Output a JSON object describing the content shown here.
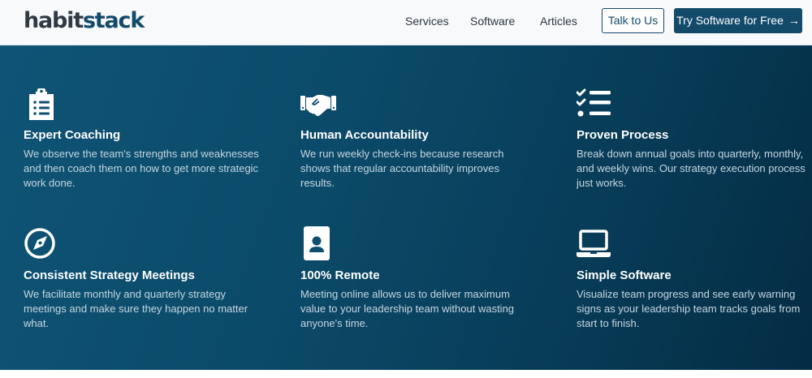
{
  "header": {
    "logo_part1": "habit",
    "logo_part2": "stack",
    "nav": [
      {
        "label": "Services"
      },
      {
        "label": "Software"
      },
      {
        "label": "Articles"
      }
    ],
    "talk_button": "Talk to Us",
    "try_button": "Try Software for Free",
    "try_button_arrow": "→"
  },
  "features": [
    {
      "icon": "clipboard-list-icon",
      "title": "Expert Coaching",
      "description": "We observe the team's strengths and weaknesses and then coach them on how to get more strategic work done."
    },
    {
      "icon": "handshake-icon",
      "title": "Human Accountability",
      "description": "We run weekly check-ins because research shows that regular accountability improves results."
    },
    {
      "icon": "checklist-icon",
      "title": "Proven Process",
      "description": "Break down annual goals into quarterly, monthly, and weekly wins. Our strategy execution process just works."
    },
    {
      "icon": "compass-icon",
      "title": "Consistent Strategy Meetings",
      "description": "We facilitate monthly and quarterly strategy meetings and make sure they happen no matter what."
    },
    {
      "icon": "id-badge-icon",
      "title": "100% Remote",
      "description": "Meeting online allows us to deliver maximum value to your leadership team without wasting anyone's time."
    },
    {
      "icon": "laptop-icon",
      "title": "Simple Software",
      "description": "Visualize team progress and see early warning signs as your leadership team tracks goals from start to finish."
    }
  ],
  "colors": {
    "brand_primary": "#134a6a",
    "hero_background": "#0b4a69",
    "header_background": "#f8f9fa",
    "feature_text": "#c7d6e0"
  }
}
